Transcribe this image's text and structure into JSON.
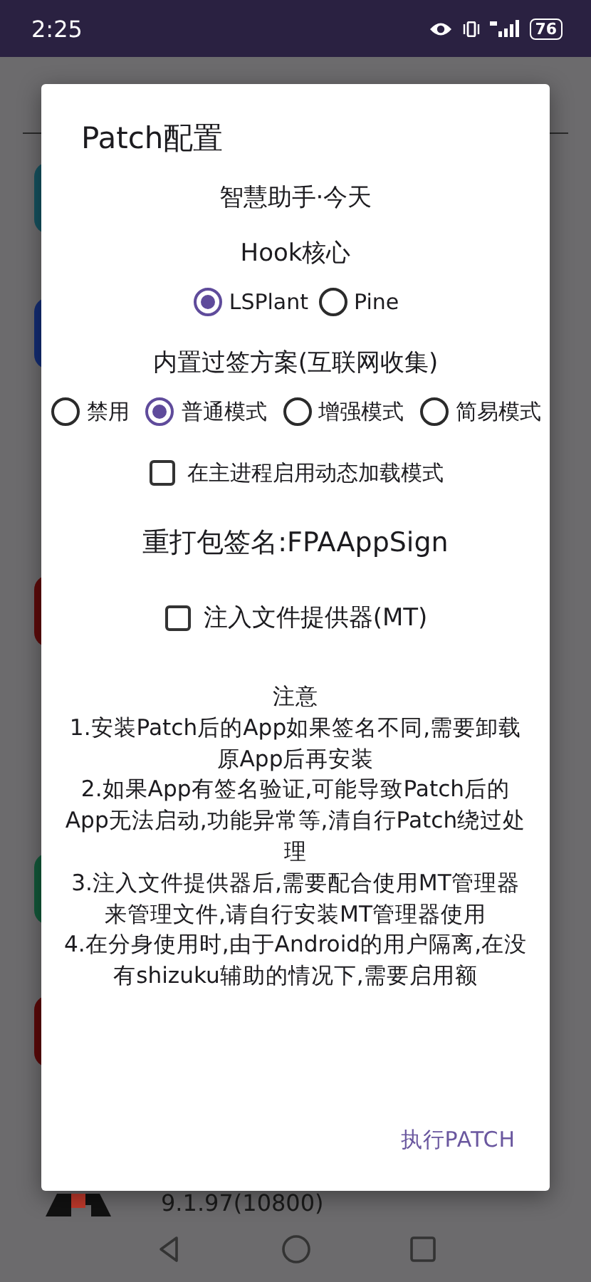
{
  "status_bar": {
    "time": "2:25",
    "battery": "76"
  },
  "background": {
    "apps": [
      {
        "color": "#16525f"
      },
      {
        "color": "#142d74"
      },
      {
        "color": "#5e0b0b"
      },
      {
        "color": "#13593a"
      },
      {
        "color": "#5c0909"
      }
    ],
    "version": "9.1.97(10800)"
  },
  "dialog": {
    "title": "Patch配置",
    "app_name": "智慧助手·今天",
    "hook_label": "Hook核心",
    "hook_options": [
      {
        "label": "LSPlant",
        "selected": true
      },
      {
        "label": "Pine",
        "selected": false
      }
    ],
    "signature_label": "内置过签方案(互联网收集)",
    "signature_options": [
      {
        "label": "禁用",
        "selected": false
      },
      {
        "label": "普通模式",
        "selected": true
      },
      {
        "label": "增强模式",
        "selected": false
      },
      {
        "label": "简易模式",
        "selected": false
      }
    ],
    "dynamic_load": {
      "label": "在主进程启用动态加载模式",
      "checked": false
    },
    "repack_signature": "重打包签名:FPAAppSign",
    "inject_provider": {
      "label": "注入文件提供器(MT)",
      "checked": false
    },
    "notes": "注意\n1.安装Patch后的App如果签名不同,需要卸载原App后再安装\n2.如果App有签名验证,可能导致Patch后的App无法启动,功能异常等,清自行Patch绕过处理\n3.注入文件提供器后,需要配合使用MT管理器来管理文件,请自行安装MT管理器使用\n4.在分身使用时,由于Android的用户隔离,在没有shizuku辅助的情况下,需要启用额",
    "action": "执行PATCH"
  }
}
